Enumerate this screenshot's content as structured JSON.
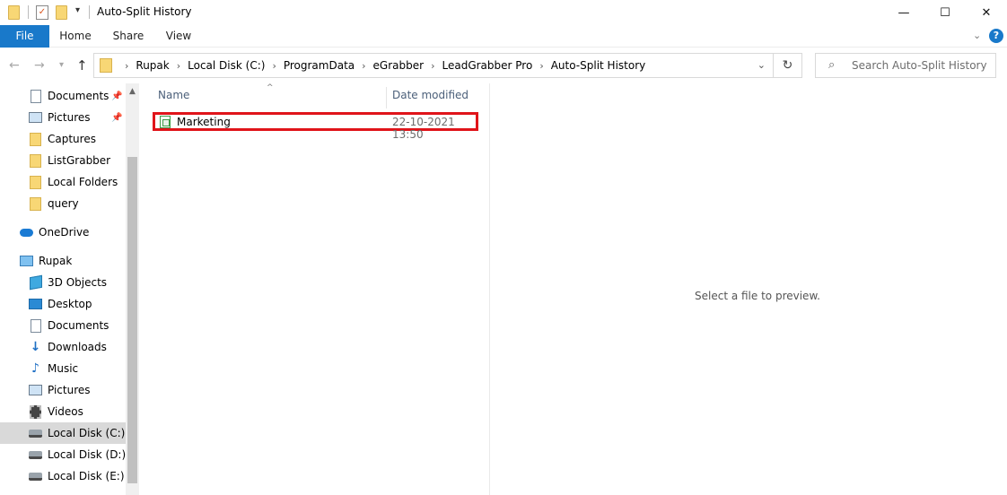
{
  "window": {
    "title": "Auto-Split History",
    "controls": {
      "minimize": "—",
      "maximize": "☐",
      "close": "✕"
    }
  },
  "ribbon": {
    "tabs": [
      "File",
      "Home",
      "Share",
      "View"
    ],
    "help": "?"
  },
  "address_bar": {
    "crumbs": [
      "Rupak",
      "Local Disk (C:)",
      "ProgramData",
      "eGrabber",
      "LeadGrabber Pro",
      "Auto-Split History"
    ]
  },
  "search": {
    "placeholder": "Search Auto-Split History"
  },
  "nav_pane": {
    "items": [
      {
        "label": "Documents",
        "icon": "documents-icon",
        "pinned": true
      },
      {
        "label": "Pictures",
        "icon": "pictures-icon",
        "pinned": true
      },
      {
        "label": "Captures",
        "icon": "folder-icon"
      },
      {
        "label": "ListGrabber",
        "icon": "folder-icon"
      },
      {
        "label": "Local Folders",
        "icon": "folder-icon"
      },
      {
        "label": "query",
        "icon": "folder-icon"
      },
      {
        "label": "OneDrive",
        "icon": "onedrive-icon"
      },
      {
        "label": "Rupak",
        "icon": "this-pc-icon"
      },
      {
        "label": "3D Objects",
        "icon": "3d-objects-icon"
      },
      {
        "label": "Desktop",
        "icon": "desktop-icon"
      },
      {
        "label": "Documents",
        "icon": "documents-icon"
      },
      {
        "label": "Downloads",
        "icon": "downloads-icon"
      },
      {
        "label": "Music",
        "icon": "music-icon"
      },
      {
        "label": "Pictures",
        "icon": "pictures-icon"
      },
      {
        "label": "Videos",
        "icon": "videos-icon"
      },
      {
        "label": "Local Disk (C:)",
        "icon": "drive-icon",
        "selected": true
      },
      {
        "label": "Local Disk (D:)",
        "icon": "drive-icon"
      },
      {
        "label": "Local Disk (E:)",
        "icon": "drive-icon"
      }
    ]
  },
  "file_list": {
    "columns": {
      "name": "Name",
      "date_modified": "Date modified"
    },
    "files": [
      {
        "name": "Marketing",
        "date_modified": "22-10-2021 13:50",
        "icon": "spreadsheet-file-icon",
        "highlighted": true
      }
    ]
  },
  "preview": {
    "message": "Select a file to preview."
  },
  "colors": {
    "accent": "#1979ca",
    "highlight_border": "#e0141a",
    "selected_bg": "#d9d9d9"
  }
}
